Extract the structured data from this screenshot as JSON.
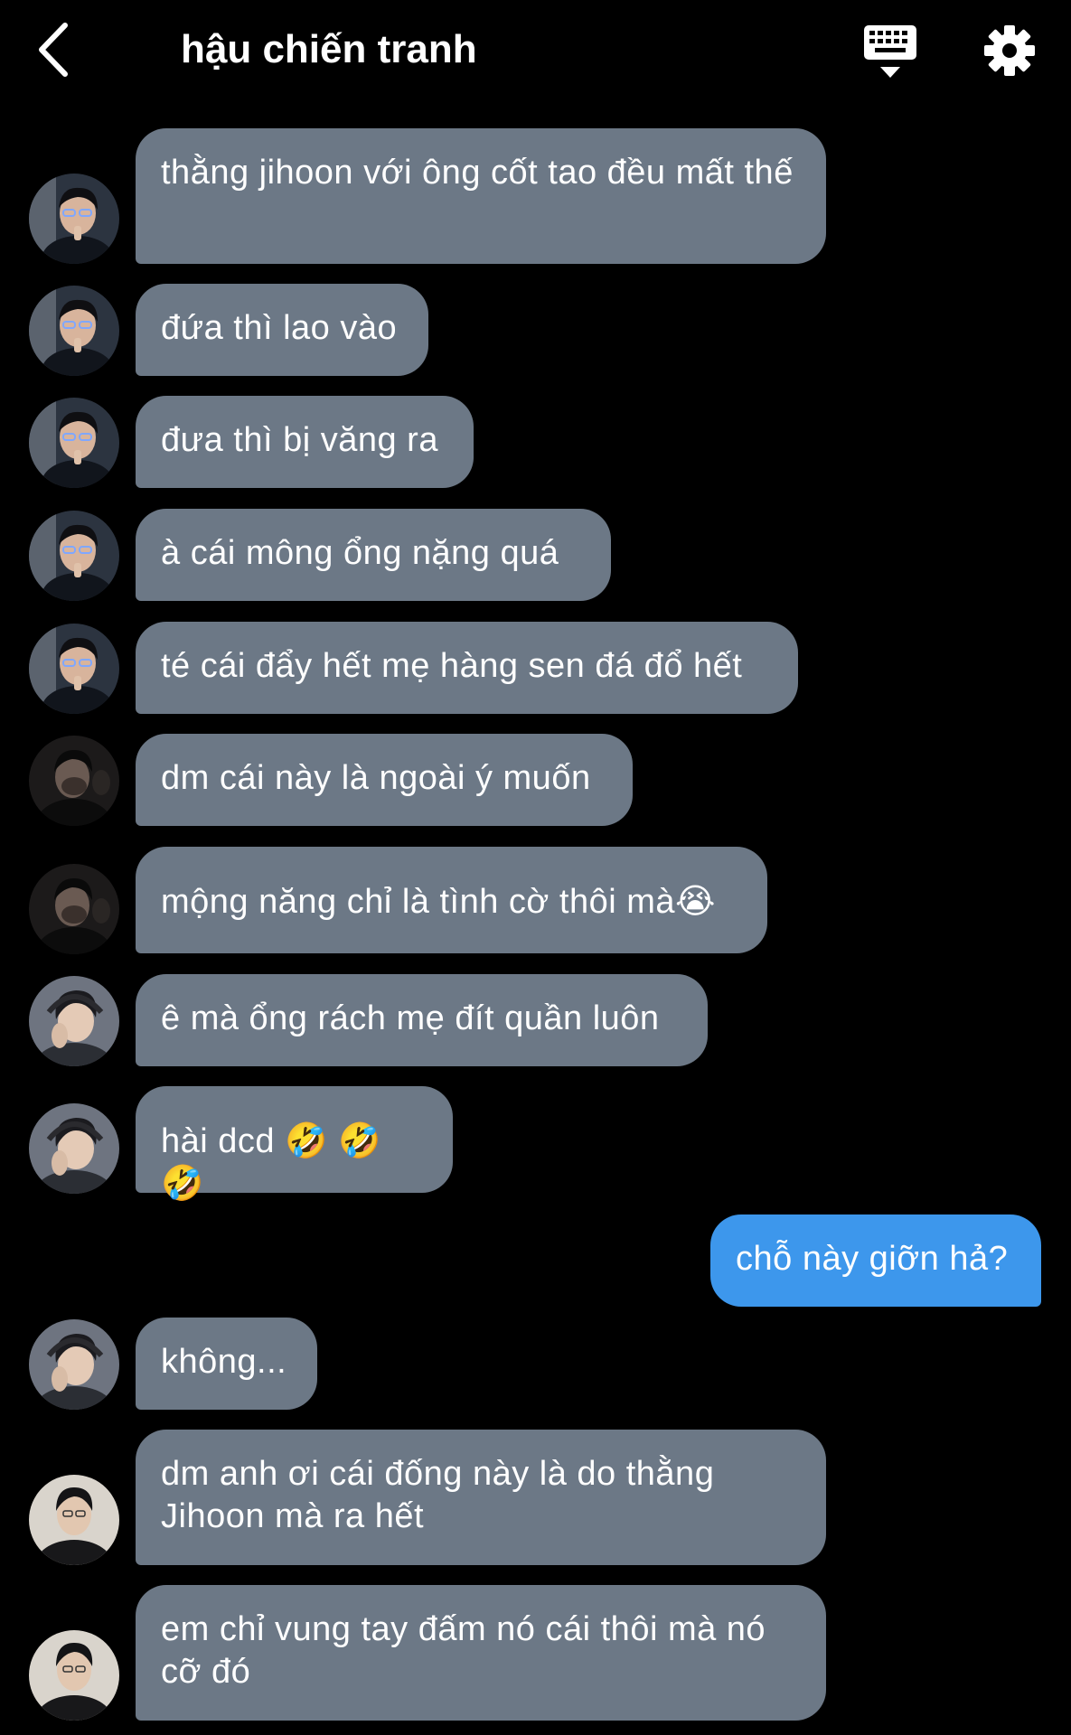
{
  "header": {
    "back_icon": "chevron-left-icon",
    "title": "hậu chiến tranh",
    "keyboard_icon": "keyboard-icon",
    "settings_icon": "gear-icon"
  },
  "colors": {
    "background": "#000000",
    "incoming_bubble": "#6c7886",
    "outgoing_bubble": "#3d97ec",
    "text": "#ffffff"
  },
  "messages": [
    {
      "sender": "avatar-a",
      "text": "thằng jihoon với ông cốt tao đều mất thế"
    },
    {
      "sender": "avatar-a",
      "text": "đứa thì lao vào"
    },
    {
      "sender": "avatar-a",
      "text": "đưa thì bị văng ra"
    },
    {
      "sender": "avatar-a",
      "text": "à cái mông ổng nặng quá"
    },
    {
      "sender": "avatar-a",
      "text": "té cái đẩy hết mẹ hàng sen đá đổ hết"
    },
    {
      "sender": "avatar-b",
      "text": "dm cái này là ngoài ý muốn"
    },
    {
      "sender": "avatar-b",
      "text": "mộng năng chỉ là tình cờ thôi mà😭"
    },
    {
      "sender": "avatar-c",
      "text": "ê mà ổng rách mẹ đít quần luôn"
    },
    {
      "sender": "avatar-c",
      "text": "hài dcd 🤣 🤣 🤣"
    },
    {
      "sender": "me",
      "text": "chỗ này giỡn hả?"
    },
    {
      "sender": "avatar-c",
      "text": "không..."
    },
    {
      "sender": "avatar-d",
      "text": "dm anh ơi cái đống này là do thằng Jihoon mà ra hết"
    },
    {
      "sender": "avatar-d",
      "text": "em chỉ vung tay đấm nó cái thôi mà nó cỡ đó"
    }
  ]
}
